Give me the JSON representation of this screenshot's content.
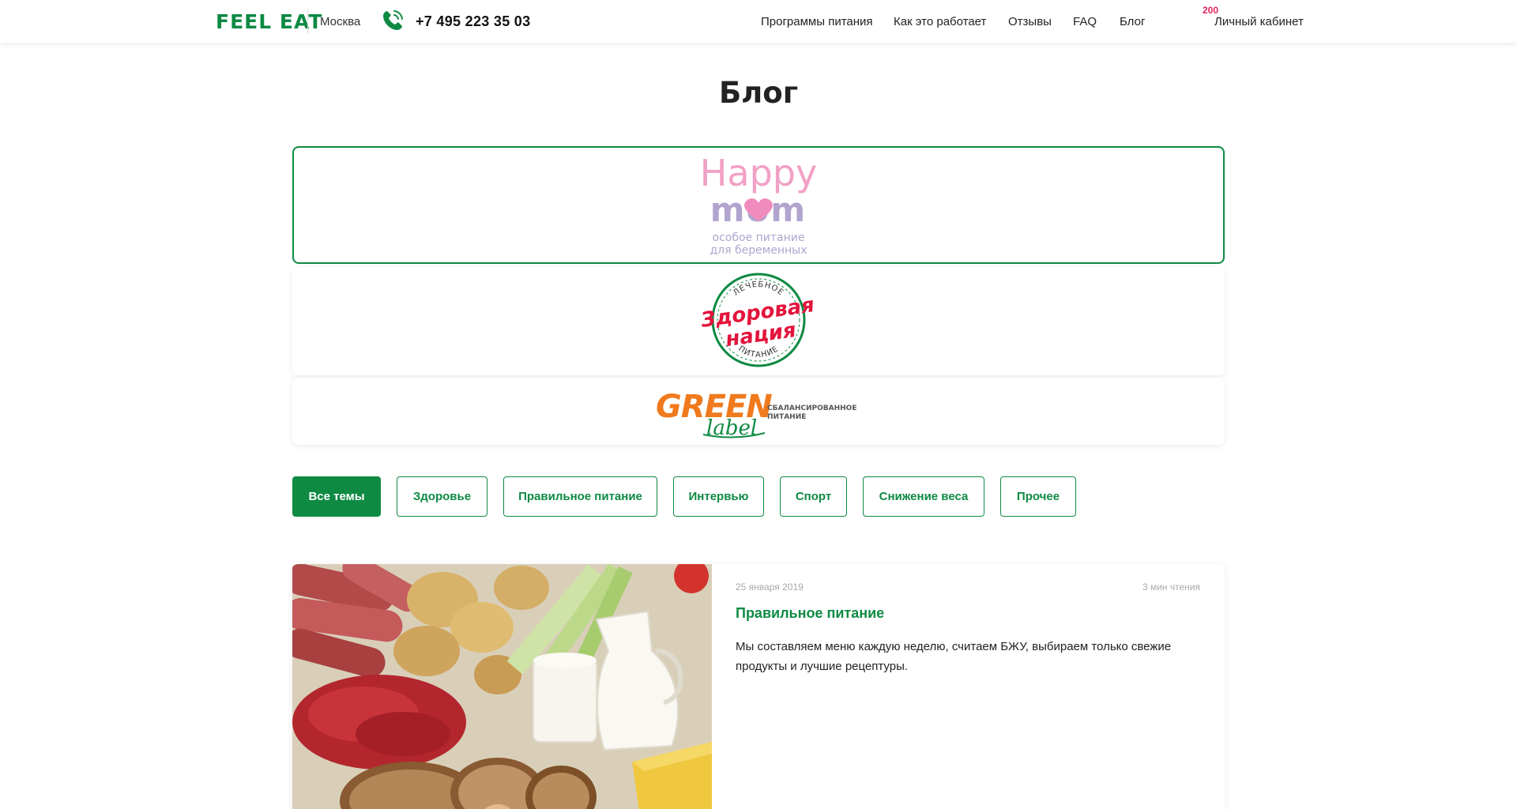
{
  "header": {
    "logo": "FEEL EAT",
    "city": "Москва",
    "phone": "+7 495 223 35 03",
    "nav": [
      "Программы питания",
      "Как это работает",
      "Отзывы",
      "FAQ",
      "Блог"
    ],
    "cart_count": "200",
    "account": "Личный кабинет"
  },
  "page": {
    "title": "Блог"
  },
  "partners": {
    "happymom": {
      "line1": "Happy",
      "line2": "mom",
      "sub1": "особое питание",
      "sub2": "для беременных"
    },
    "nation": {
      "top": "ЛЕЧЕБНОЕ",
      "line1": "Здоровая",
      "line2": "нация",
      "bottom": "ПИТАНИЕ"
    },
    "green": {
      "word1": "GREEN",
      "word2": "label",
      "sub1": "СБАЛАНСИРОВАННОЕ",
      "sub2": "ПИТАНИЕ"
    }
  },
  "topics": [
    "Все темы",
    "Здоровье",
    "Правильное питание",
    "Интервью",
    "Спорт",
    "Снижение веса",
    "Прочее"
  ],
  "article": {
    "date": "25 января 2019",
    "read_time": "3 мин чтения",
    "title": "Правильное питание",
    "text": "Мы составляем меню каждую неделю, считаем БЖУ, выбираем только свежие продукты и лучшие рецептуры."
  },
  "colors": {
    "accent": "#0e8a43",
    "badge": "#e0245e",
    "happy_pink": "#f2a0c6",
    "happy_purple": "#b1a5cf",
    "nation_red": "#e3143c",
    "green_orange": "#f07a1d"
  }
}
